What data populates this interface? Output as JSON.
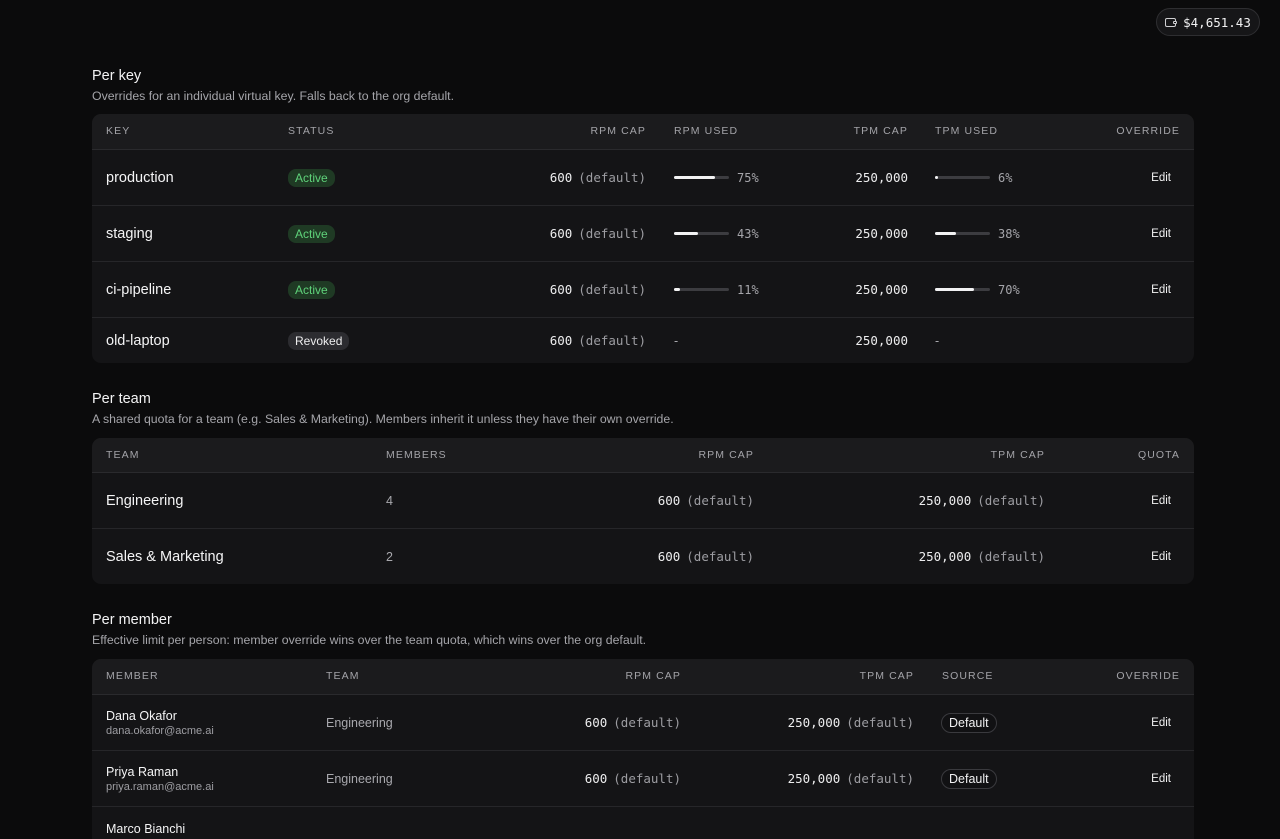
{
  "balance": {
    "amount": "$4,651.43",
    "icon": "wallet-icon"
  },
  "per_key": {
    "title": "Per key",
    "subtitle": "Overrides for an individual virtual key. Falls back to the org default.",
    "columns": [
      "KEY",
      "STATUS",
      "RPM CAP",
      "RPM USED",
      "TPM CAP",
      "TPM USED",
      "OVERRIDE"
    ],
    "rows": [
      {
        "key": "production",
        "status": "Active",
        "rpm_cap": "600",
        "rpm_cap_note": "(default)",
        "rpm_used_pct": 75,
        "rpm_used": "75%",
        "tpm_cap": "250,000",
        "tpm_used_pct": 6,
        "tpm_used": "6%",
        "action": "Edit"
      },
      {
        "key": "staging",
        "status": "Active",
        "rpm_cap": "600",
        "rpm_cap_note": "(default)",
        "rpm_used_pct": 43,
        "rpm_used": "43%",
        "tpm_cap": "250,000",
        "tpm_used_pct": 38,
        "tpm_used": "38%",
        "action": "Edit"
      },
      {
        "key": "ci-pipeline",
        "status": "Active",
        "rpm_cap": "600",
        "rpm_cap_note": "(default)",
        "rpm_used_pct": 11,
        "rpm_used": "11%",
        "tpm_cap": "250,000",
        "tpm_used_pct": 70,
        "tpm_used": "70%",
        "action": "Edit"
      },
      {
        "key": "old-laptop",
        "status": "Revoked",
        "rpm_cap": "600",
        "rpm_cap_note": "(default)",
        "rpm_used": "-",
        "tpm_cap": "250,000",
        "tpm_used": "-"
      }
    ]
  },
  "per_team": {
    "title": "Per team",
    "subtitle": "A shared quota for a team (e.g. Sales & Marketing). Members inherit it unless they have their own override.",
    "columns": [
      "TEAM",
      "MEMBERS",
      "RPM CAP",
      "TPM CAP",
      "QUOTA"
    ],
    "rows": [
      {
        "team": "Engineering",
        "members": "4",
        "rpm_cap": "600",
        "rpm_cap_note": "(default)",
        "tpm_cap": "250,000",
        "tpm_cap_note": "(default)",
        "action": "Edit"
      },
      {
        "team": "Sales & Marketing",
        "members": "2",
        "rpm_cap": "600",
        "rpm_cap_note": "(default)",
        "tpm_cap": "250,000",
        "tpm_cap_note": "(default)",
        "action": "Edit"
      }
    ]
  },
  "per_member": {
    "title": "Per member",
    "subtitle": "Effective limit per person: member override wins over the team quota, which wins over the org default.",
    "columns": [
      "MEMBER",
      "TEAM",
      "RPM CAP",
      "TPM CAP",
      "SOURCE",
      "OVERRIDE"
    ],
    "rows": [
      {
        "name": "Dana Okafor",
        "email": "dana.okafor@acme.ai",
        "team": "Engineering",
        "rpm_cap": "600",
        "rpm_cap_note": "(default)",
        "tpm_cap": "250,000",
        "tpm_cap_note": "(default)",
        "source": "Default",
        "action": "Edit"
      },
      {
        "name": "Priya Raman",
        "email": "priya.raman@acme.ai",
        "team": "Engineering",
        "rpm_cap": "600",
        "rpm_cap_note": "(default)",
        "tpm_cap": "250,000",
        "tpm_cap_note": "(default)",
        "source": "Default",
        "action": "Edit"
      },
      {
        "name": "Marco Bianchi"
      }
    ]
  }
}
